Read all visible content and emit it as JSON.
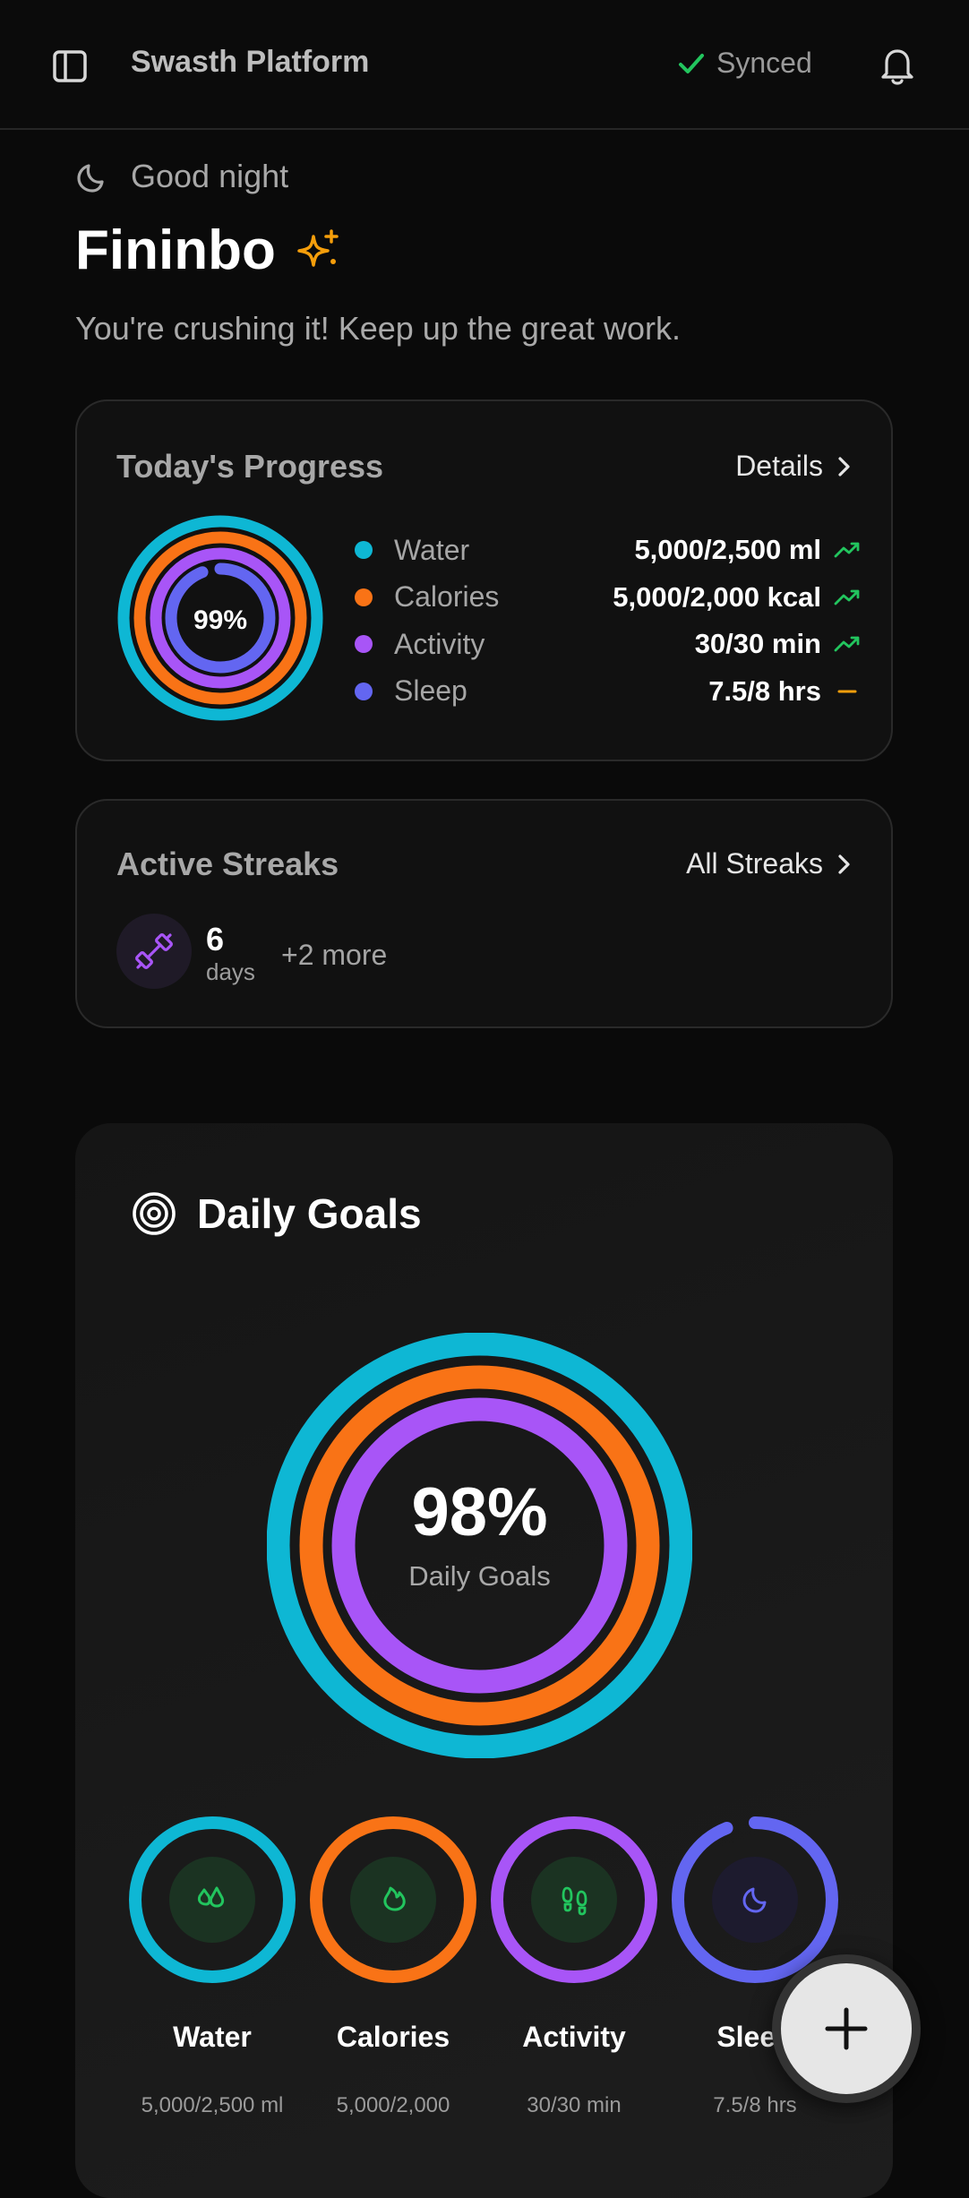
{
  "header": {
    "app_title": "Swasth Platform",
    "sync_status": "Synced",
    "icons": [
      "sidebar-toggle-icon",
      "check-icon",
      "bell-icon"
    ]
  },
  "greeting": {
    "salutation": "Good night",
    "user_name": "Fininbo",
    "motivation": "You're crushing it! Keep up the great work."
  },
  "progress_card": {
    "title": "Today's Progress",
    "link": "Details",
    "overall_percent": "99%",
    "metrics": [
      {
        "name": "Water",
        "value": "5,000/2,500 ml",
        "color": "#0eb7d4",
        "trend": "up",
        "progress": 1.0
      },
      {
        "name": "Calories",
        "value": "5,000/2,000 kcal",
        "color": "#f97316",
        "trend": "up",
        "progress": 1.0
      },
      {
        "name": "Activity",
        "value": "30/30 min",
        "color": "#a855f7",
        "trend": "up",
        "progress": 1.0
      },
      {
        "name": "Sleep",
        "value": "7.5/8 hrs",
        "color": "#6366f1",
        "trend": "flat",
        "progress": 0.94
      }
    ]
  },
  "streaks_card": {
    "title": "Active Streaks",
    "link": "All Streaks",
    "streak_count": "6",
    "streak_unit": "days",
    "more": "+2 more"
  },
  "goals_card": {
    "title": "Daily Goals",
    "percent": "98%",
    "subtitle": "Daily Goals",
    "goals": [
      {
        "label": "Water",
        "value": "5,000/2,500 ml",
        "color": "#0eb7d4",
        "icon": "water-drops-icon",
        "progress": 1.0
      },
      {
        "label": "Calories",
        "value": "5,000/2,000",
        "color": "#f97316",
        "icon": "flame-icon",
        "progress": 1.0
      },
      {
        "label": "Activity",
        "value": "30/30 min",
        "color": "#a855f7",
        "icon": "footprints-icon",
        "progress": 1.0
      },
      {
        "label": "Sleep",
        "value": "7.5/8 hrs",
        "color": "#6366f1",
        "icon": "moon-icon",
        "progress": 0.94
      }
    ]
  },
  "colors": {
    "trend_up": "#22c55e",
    "trend_flat": "#f59e0b",
    "accent_sparkle": "#f59e0b",
    "goal_icon": "#22c55e",
    "streak_icon": "#a855f7"
  }
}
